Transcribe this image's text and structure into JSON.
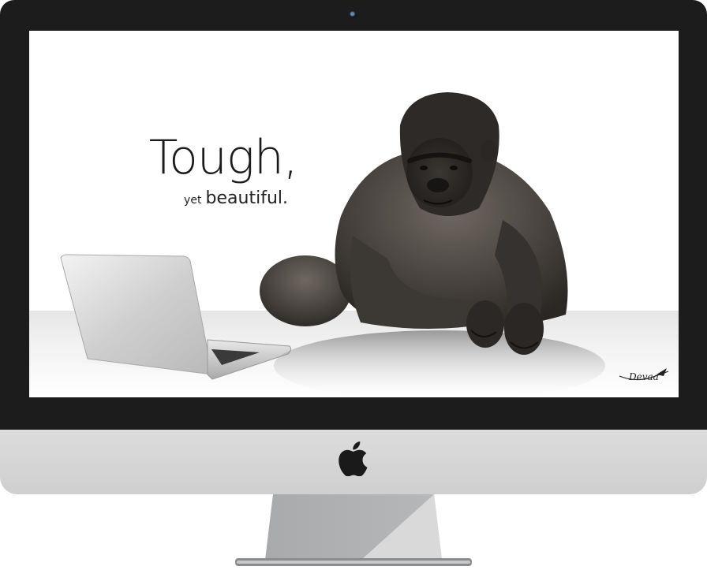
{
  "screen": {
    "headline": "Tough,",
    "subline_small": "yet",
    "subline_big": "beautiful.",
    "signature": "Devaa"
  },
  "monitor": {
    "logo": "apple-logo-icon",
    "bezel_color": "#1c1c1d",
    "chin_color": "#d4d4d4"
  },
  "illustrations": {
    "device": "laptop",
    "animal": "gorilla"
  }
}
